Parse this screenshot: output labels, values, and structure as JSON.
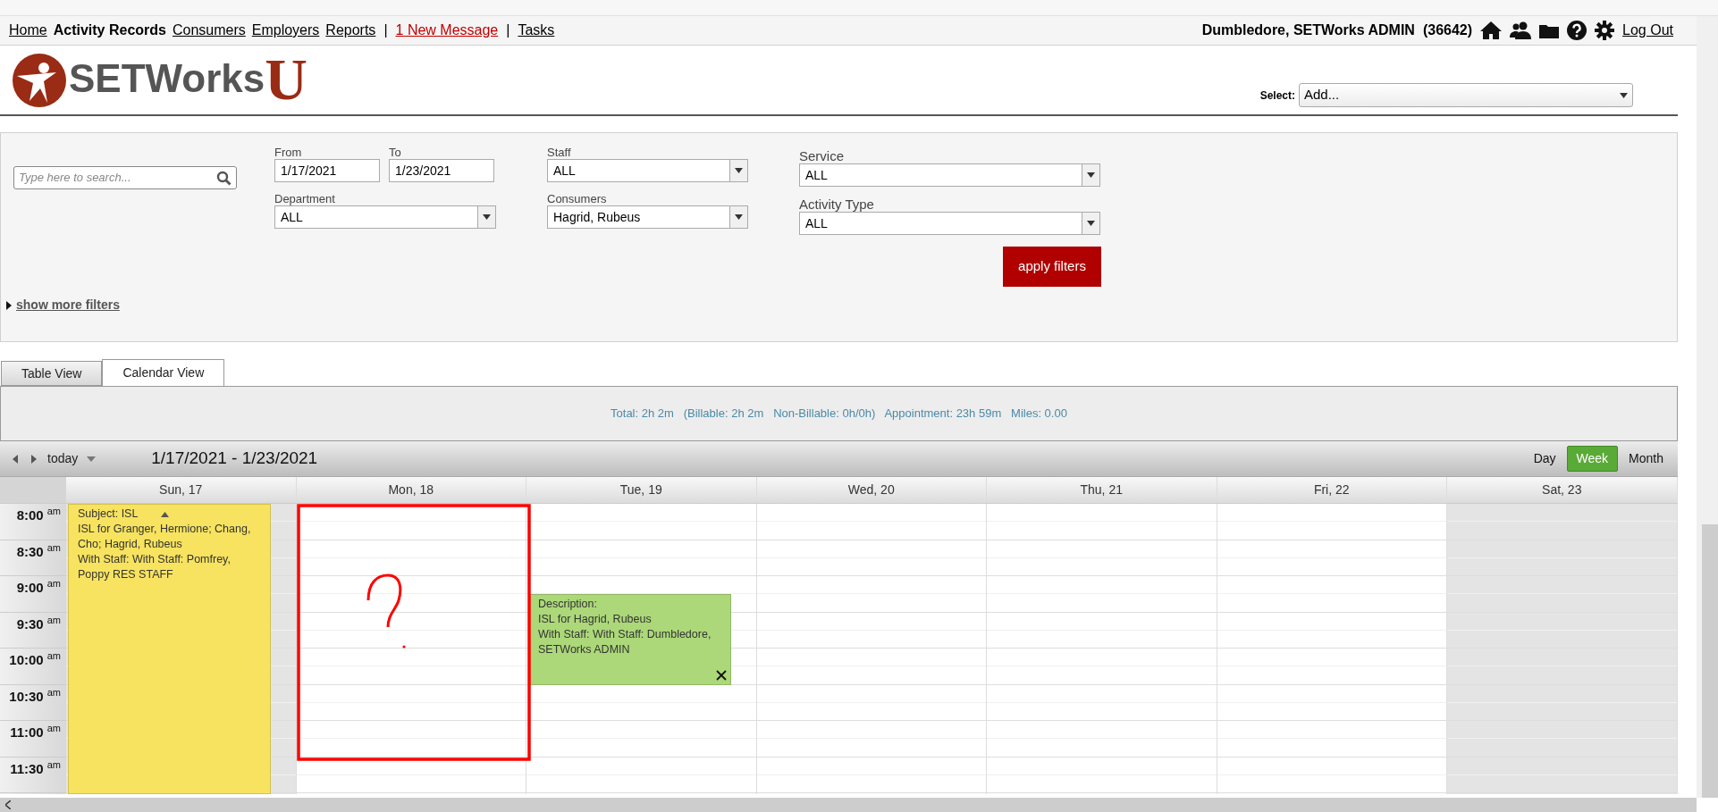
{
  "nav": {
    "links": [
      {
        "label": "Home",
        "kind": "link"
      },
      {
        "label": "Activity Records",
        "kind": "current"
      },
      {
        "label": "Consumers",
        "kind": "link"
      },
      {
        "label": "Employers",
        "kind": "link"
      },
      {
        "label": "Reports",
        "kind": "link"
      },
      {
        "label": "|",
        "kind": "separator"
      },
      {
        "label": "1 New Message",
        "kind": "alert"
      },
      {
        "label": "|",
        "kind": "separator"
      },
      {
        "label": "Tasks",
        "kind": "link"
      }
    ],
    "user": "Dumbledore, SETWorks ADMIN",
    "user_id": "(36642)",
    "logout": "Log Out"
  },
  "logo": {
    "text": "SETWorks",
    "mark": "U"
  },
  "add_select": {
    "label": "Select:",
    "value": "Add..."
  },
  "filters": {
    "search": {
      "placeholder": "Type here to search..."
    },
    "from": {
      "label": "From",
      "value": "1/17/2021"
    },
    "to": {
      "label": "To",
      "value": "1/23/2021"
    },
    "department": {
      "label": "Department",
      "value": "ALL"
    },
    "staff": {
      "label": "Staff",
      "value": "ALL"
    },
    "consumers": {
      "label": "Consumers",
      "value": "Hagrid, Rubeus"
    },
    "service": {
      "label": "Service",
      "value": "ALL"
    },
    "activity_type": {
      "label": "Activity Type",
      "value": "ALL"
    },
    "apply": "apply filters",
    "more": "show more filters"
  },
  "tabs": [
    {
      "label": "Table View",
      "selected": false
    },
    {
      "label": "Calendar View",
      "selected": true
    }
  ],
  "summary": "Total: 2h 2m   (Billable: 2h 2m   Non-Billable: 0h/0h)   Appointment: 23h 59m   Miles: 0.00",
  "calendar": {
    "today": "today",
    "range": "1/17/2021 - 1/23/2021",
    "views": [
      {
        "label": "Day",
        "selected": false
      },
      {
        "label": "Week",
        "selected": true
      },
      {
        "label": "Month",
        "selected": false
      }
    ],
    "days": [
      {
        "label": "Sun, 17",
        "weekend": true
      },
      {
        "label": "Mon, 18",
        "weekend": false
      },
      {
        "label": "Tue, 19",
        "weekend": false
      },
      {
        "label": "Wed, 20",
        "weekend": false
      },
      {
        "label": "Thu, 21",
        "weekend": false
      },
      {
        "label": "Fri, 22",
        "weekend": false
      },
      {
        "label": "Sat, 23",
        "weekend": true
      }
    ],
    "times": [
      {
        "time": "8:00",
        "period": "am"
      },
      {
        "time": "8:30",
        "period": "am"
      },
      {
        "time": "9:00",
        "period": "am"
      },
      {
        "time": "9:30",
        "period": "am"
      },
      {
        "time": "10:00",
        "period": "am"
      },
      {
        "time": "10:30",
        "period": "am"
      },
      {
        "time": "11:00",
        "period": "am"
      },
      {
        "time": "11:30",
        "period": "am"
      }
    ],
    "events": [
      {
        "color": "#f7e35f",
        "lines": [
          "Subject: ISL",
          "ISL for Granger, Hermione; Chang, Cho; Hagrid, Rubeus",
          "With Staff: With Staff: Pomfrey, Poppy RES STAFF"
        ],
        "kind": "collapse"
      },
      {
        "color": "#acd879",
        "lines": [
          "Description:",
          "ISL for Hagrid, Rubeus",
          "With Staff: With Staff: Dumbledore, SETWorks ADMIN"
        ],
        "kind": "close"
      }
    ]
  },
  "annotation": {
    "kind": "question-box"
  }
}
